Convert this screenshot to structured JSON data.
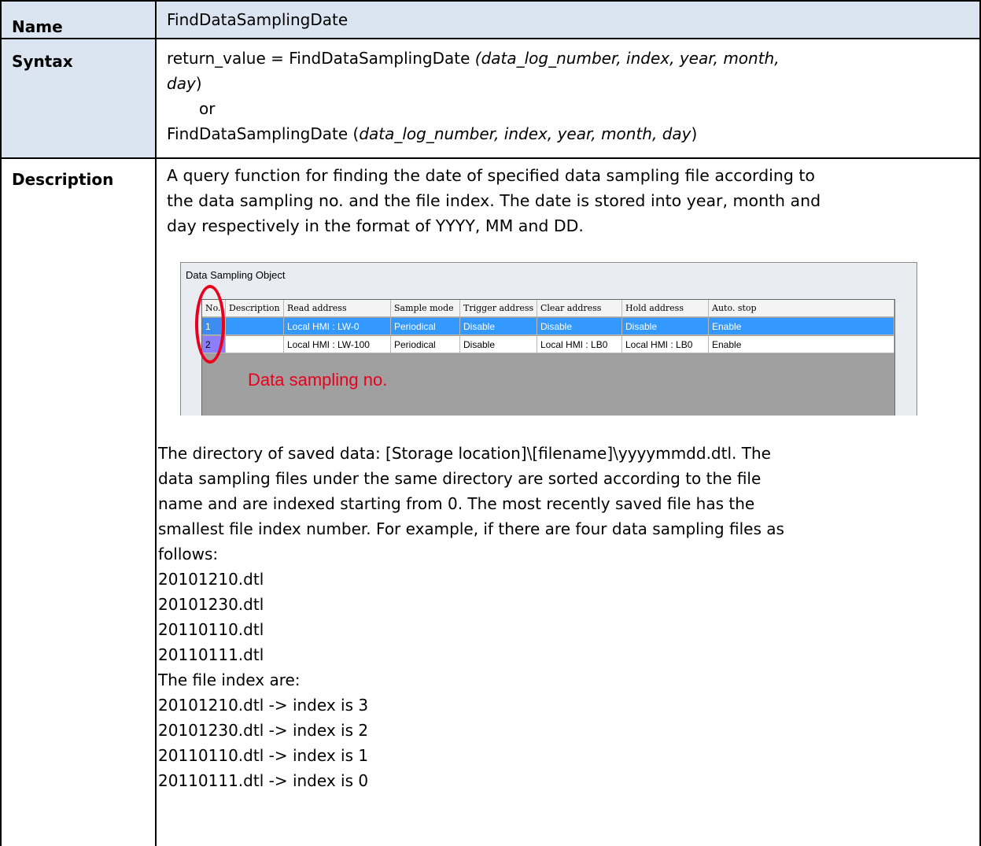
{
  "name": {
    "label": "Name",
    "value": "FindDataSamplingDate"
  },
  "syntax": {
    "label": "Syntax",
    "line1_prefix": "return_value = FindDataSamplingDate ",
    "line1_args": "(data_log_number, index, year, month,",
    "line2_arg": "day",
    "line2_suffix": ")",
    "or": "or",
    "line4_prefix": "FindDataSamplingDate (",
    "line4_args": "data_log_number, index, year, month, day",
    "line4_suffix": ")"
  },
  "description": {
    "label": "Description",
    "intro": [
      "A query function for finding the date of specified data sampling file according to",
      "the data sampling no. and the file index. The date is stored into year, month and",
      "day respectively in the format of YYYY, MM and DD."
    ],
    "body": [
      "The directory of saved data: [Storage location]\\[filename]\\yyyymmdd.dtl. The",
      "data sampling files under the same directory are sorted according to the file",
      "name and are indexed starting from 0. The most recently saved file has the",
      "smallest file index number. For example, if there are four data sampling files as",
      "follows:",
      "20101210.dtl",
      "20101230.dtl",
      "20110110.dtl",
      "20110111.dtl",
      "The file index are:",
      "20101210.dtl -> index is 3",
      "20101230.dtl -> index is 2",
      "20110110.dtl -> index is 1",
      "20110111.dtl -> index is 0"
    ]
  },
  "screenshot": {
    "window_title": "Data Sampling Object",
    "columns": [
      "No.",
      "Description",
      "Read address",
      "Sample mode",
      "Trigger address",
      "Clear address",
      "Hold address",
      "Auto. stop"
    ],
    "rows": [
      [
        "1",
        "",
        "Local HMI : LW-0",
        "Periodical",
        "Disable",
        "Disable",
        "Disable",
        "Enable"
      ],
      [
        "2",
        "",
        "Local HMI : LW-100",
        "Periodical",
        "Disable",
        "Local HMI : LB0",
        "Local HMI : LB0",
        "Enable"
      ]
    ],
    "annotation": "Data sampling no."
  },
  "colors": {
    "label_bg": "#dbe5f1",
    "highlight_row": "#3399ff",
    "annotation_red": "#e8001c"
  }
}
